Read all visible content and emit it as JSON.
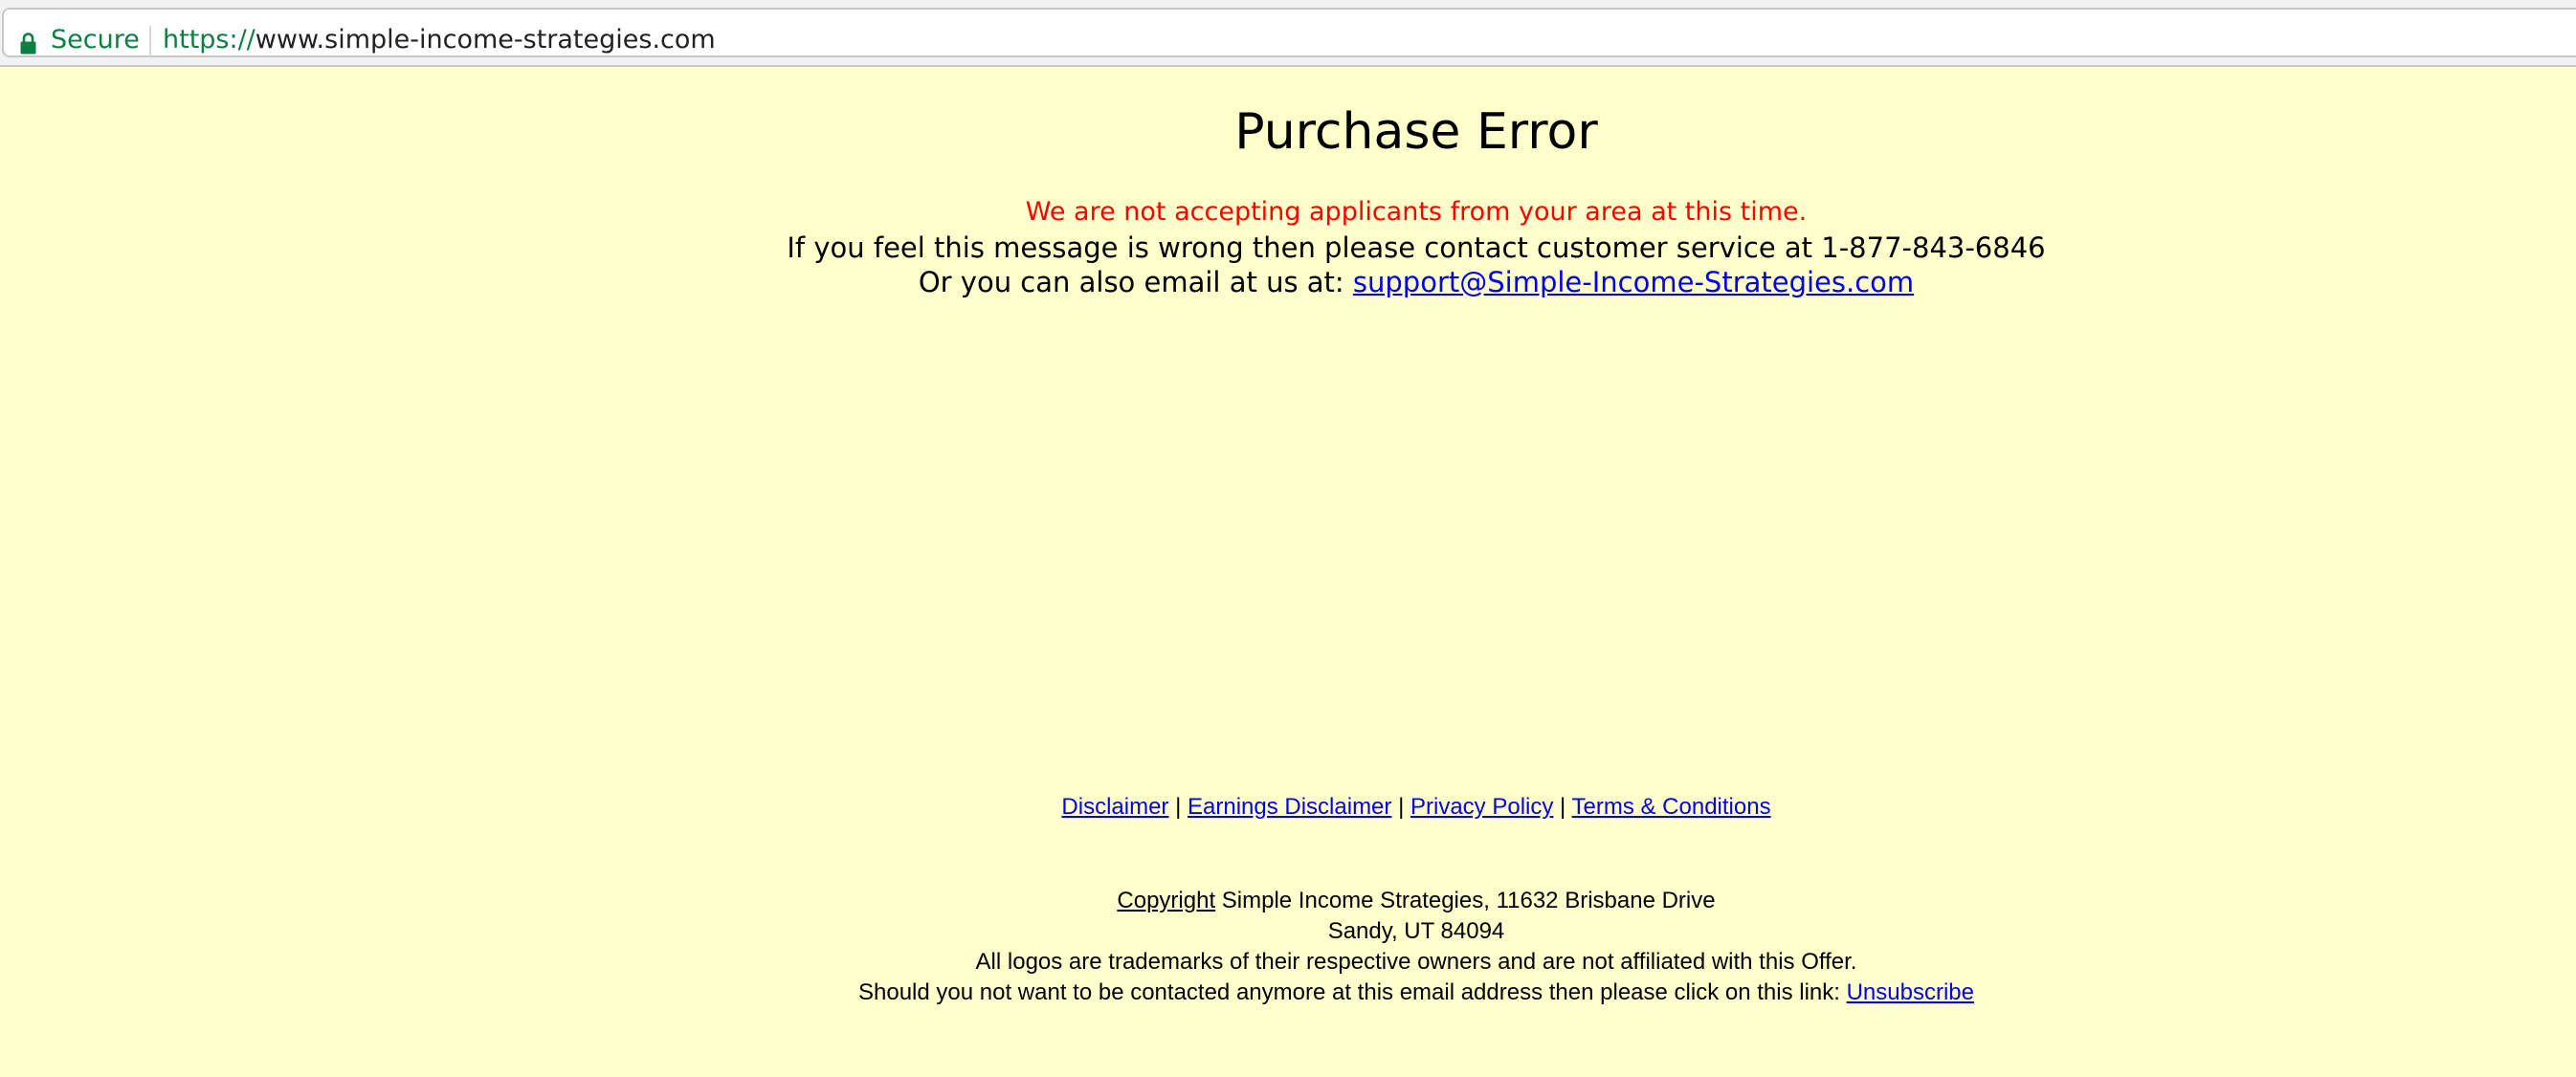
{
  "browser": {
    "secure_label": "Secure",
    "url_scheme": "https://",
    "url_host": "www.simple-income-strategies.com",
    "lock_icon": "lock-icon",
    "secure_color": "#0b8043"
  },
  "page": {
    "background": "#ffffcc",
    "title": "Purchase Error",
    "error_message": "We are not accepting applicants from your area at this time.",
    "contact_line": "If you feel this message is wrong then please contact customer service at 1-877-843-6846",
    "email_prefix": "Or you can also email at us at:",
    "email_link": "support@Simple-Income-Strategies.com"
  },
  "footer": {
    "links": [
      {
        "label": "Disclaimer"
      },
      {
        "label": "Earnings Disclaimer"
      },
      {
        "label": "Privacy Policy"
      },
      {
        "label": "Terms & Conditions"
      }
    ],
    "separator": "|",
    "copyright_link": "Copyright",
    "address_line1": "Simple Income Strategies, 11632 Brisbane Drive",
    "address_line2": "Sandy, UT 84094",
    "trademark_notice": "All logos are trademarks of their respective owners and are not affiliated with this Offer.",
    "unsubscribe_text": "Should you not want to be contacted anymore at this email address then please click on this link:",
    "unsubscribe_link": "Unsubscribe"
  }
}
